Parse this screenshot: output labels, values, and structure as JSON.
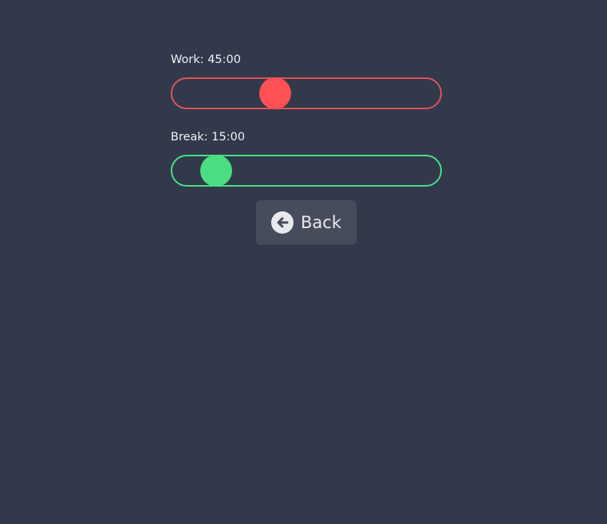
{
  "settings": {
    "work": {
      "label": "Work: 45:00",
      "level": 0.385,
      "color": "#e05255",
      "thumb_color": "#ff5055"
    },
    "break": {
      "label": "Break: 15:00",
      "level": 0.165,
      "color": "#4ade80",
      "thumb_color": "#4ade80"
    }
  },
  "back_button": {
    "label": "Back",
    "icon": "arrow-left-circle-icon"
  },
  "colors": {
    "background": "#31394b",
    "button_background": "#474c5b",
    "text": "#f1f1f4"
  }
}
